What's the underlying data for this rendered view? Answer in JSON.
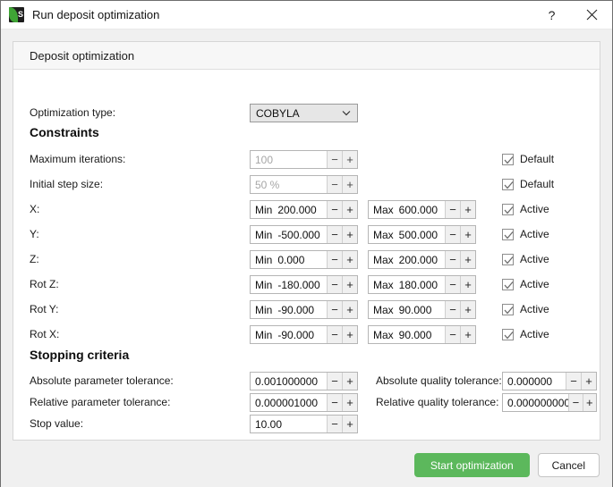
{
  "titlebar": {
    "title": "Run deposit optimization",
    "app_icon": "as-logo-icon",
    "icon_glyph": "S",
    "help_label": "?",
    "help_icon": "help-icon",
    "close_icon": "close-icon"
  },
  "group": {
    "header": "Deposit optimization"
  },
  "optimization_type": {
    "label": "Optimization type:",
    "value": "COBYLA",
    "chevron": "chevron-down-icon"
  },
  "sections": {
    "constraints": "Constraints",
    "stopping": "Stopping criteria"
  },
  "constraints": [
    {
      "label": "Maximum iterations:",
      "kind": "single",
      "disabled": true,
      "value": "100",
      "check": "Default",
      "checked": true
    },
    {
      "label": "Initial step size:",
      "kind": "single",
      "disabled": true,
      "value": "50 %",
      "check": "Default",
      "checked": true
    },
    {
      "label": "X:",
      "kind": "range",
      "disabled": false,
      "min_prefix": "Min",
      "min_value": "200.000",
      "max_prefix": "Max",
      "max_value": "600.000",
      "check": "Active",
      "checked": true
    },
    {
      "label": "Y:",
      "kind": "range",
      "disabled": false,
      "min_prefix": "Min",
      "min_value": "-500.000",
      "max_prefix": "Max",
      "max_value": "500.000",
      "check": "Active",
      "checked": true
    },
    {
      "label": "Z:",
      "kind": "range",
      "disabled": false,
      "min_prefix": "Min",
      "min_value": "0.000",
      "max_prefix": "Max",
      "max_value": "200.000",
      "check": "Active",
      "checked": true
    },
    {
      "label": "Rot Z:",
      "kind": "range",
      "disabled": false,
      "min_prefix": "Min",
      "min_value": "-180.000",
      "max_prefix": "Max",
      "max_value": "180.000",
      "check": "Active",
      "checked": true
    },
    {
      "label": "Rot Y:",
      "kind": "range",
      "disabled": false,
      "min_prefix": "Min",
      "min_value": "-90.000",
      "max_prefix": "Max",
      "max_value": "90.000",
      "check": "Active",
      "checked": true
    },
    {
      "label": "Rot X:",
      "kind": "range",
      "disabled": false,
      "min_prefix": "Min",
      "min_value": "-90.000",
      "max_prefix": "Max",
      "max_value": "90.000",
      "check": "Active",
      "checked": true
    }
  ],
  "stopping": [
    {
      "label": "Absolute parameter tolerance:",
      "value": "0.001000000",
      "right_label": "Absolute quality tolerance:",
      "right_value": "0.000000"
    },
    {
      "label": "Relative parameter tolerance:",
      "value": "0.000001000",
      "right_label": "Relative quality tolerance:",
      "right_value": "0.000000000"
    },
    {
      "label": "Stop value:",
      "value": "10.00",
      "right_label": "",
      "right_value": ""
    }
  ],
  "spinner": {
    "minus": "−",
    "plus": "+"
  },
  "footer": {
    "start_label": "Start optimization",
    "cancel_label": "Cancel"
  },
  "colors": {
    "accent_green": "#5cb85c",
    "window_bg": "#f0f0f0",
    "panel_bg": "#ffffff"
  }
}
